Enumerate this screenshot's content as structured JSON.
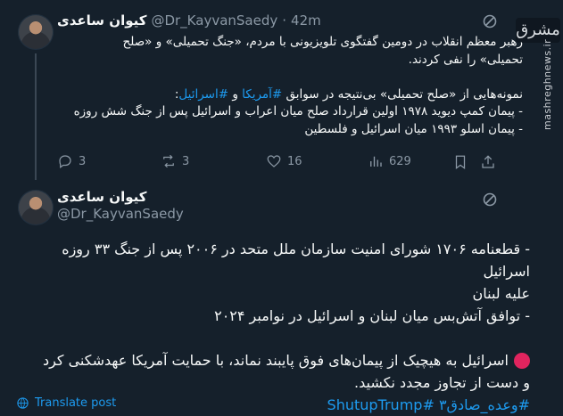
{
  "tweet1": {
    "display_name": "کیوان ساعدی",
    "handle": "@Dr_KayvanSaedy",
    "separator": "·",
    "time": "42m",
    "lines": [
      "رهبر معظم انقلاب در دومین گفتگوی تلویزیونی با مردم، «جنگ تحمیلی» و «صلح",
      "تحمیلی» را نفی کردند.",
      "",
      "نمونه‌هایی از «صلح تحمیلی» بی‌نتیجه در سوابق #آمریکا و #اسرائیل:",
      "- پیمان کمپ دیوید ۱۹۷۸ اولین قرارداد صلح میان اعراب و اسرائیل پس از جنگ شش روزه",
      "- پیمان اسلو ۱۹۹۳ میان اسرائیل و فلسطین"
    ],
    "actions": {
      "replies": "3",
      "retweets": "3",
      "likes": "16",
      "views": "629"
    }
  },
  "tweet2": {
    "display_name": "کیوان ساعدی",
    "handle": "@Dr_KayvanSaedy",
    "lines": [
      "- قطعنامه ۱۷۰۶ شورای امنیت سازمان ملل متحد در ۲۰۰۶ پس از جنگ ۳۳ روزه اسرائیل",
      "علیه لبنان",
      "- توافق آتش‌بس میان لبنان و اسرائیل در نوامبر ۲۰۲۴",
      "",
      "اسرائیل به هیچیک از پیمان‌های فوق پایبند نماند، با حمایت آمریکا عهدشکنی کرد",
      "و دست از تجاوز مجدد نکشید."
    ],
    "hashtags": "#وعده_صادق۳ #ShutupTrump",
    "translate": "Translate post"
  },
  "watermark": {
    "logo": "مشرق",
    "text": "mashreghnews.ir"
  },
  "colors": {
    "background": "#15202b",
    "link": "#1d9bf0",
    "muted": "#8b98a5",
    "red_circle": "#e0245e"
  }
}
